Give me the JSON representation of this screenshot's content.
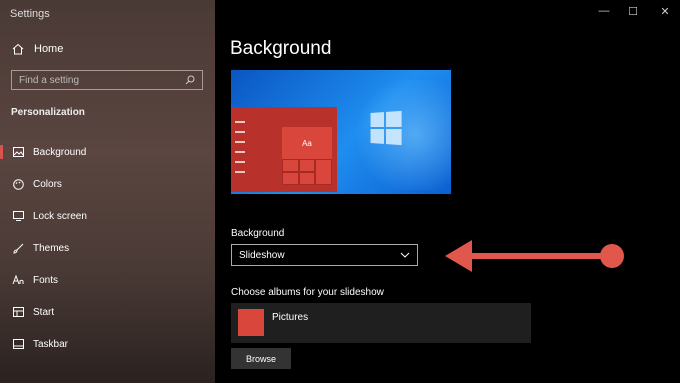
{
  "window": {
    "title": "Settings",
    "minimize": "—",
    "maximize": "☐",
    "close": "✕"
  },
  "sidebar": {
    "home": {
      "label": "Home",
      "icon": "home-icon"
    },
    "search": {
      "placeholder": "Find a setting",
      "icon": "search-icon"
    },
    "section_title": "Personalization",
    "items": [
      {
        "label": "Background",
        "icon": "picture-icon",
        "active": true
      },
      {
        "label": "Colors",
        "icon": "palette-icon",
        "active": false
      },
      {
        "label": "Lock screen",
        "icon": "lock-screen-icon",
        "active": false
      },
      {
        "label": "Themes",
        "icon": "brush-icon",
        "active": false
      },
      {
        "label": "Fonts",
        "icon": "font-icon",
        "active": false
      },
      {
        "label": "Start",
        "icon": "start-icon",
        "active": false
      },
      {
        "label": "Taskbar",
        "icon": "taskbar-icon",
        "active": false
      }
    ]
  },
  "main": {
    "heading": "Background",
    "preview": {
      "sample_text": "Aa"
    },
    "background_label": "Background",
    "background_value": "Slideshow",
    "albums_label": "Choose albums for your slideshow",
    "album_name": "Pictures",
    "browse_label": "Browse"
  },
  "colors": {
    "accent": "#d9463c",
    "arrow": "#e2574c"
  }
}
